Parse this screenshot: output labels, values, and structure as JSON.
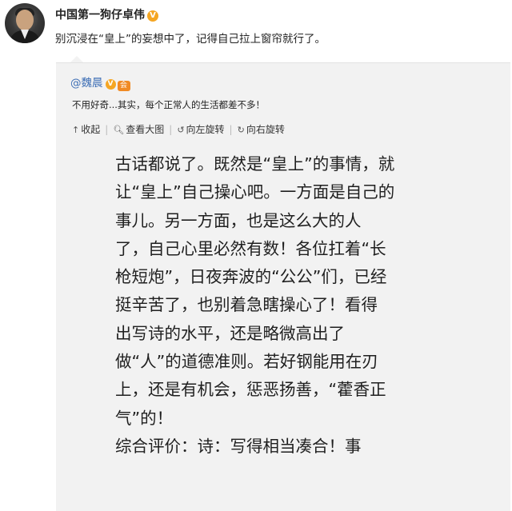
{
  "post": {
    "author": "中国第一狗仔卓伟",
    "verified_mark": "V",
    "text": "别沉浸在“皇上”的妄想中了，记得自己拉上窗帘就行了。"
  },
  "repost": {
    "author": "@魏晨",
    "verified_mark": "V",
    "member_mark": "会",
    "text": "不用好奇...其实，每个正常人的生活都差不多！",
    "toolbar": {
      "collapse": "收起",
      "view_large": "查看大图",
      "rotate_left": "向左旋转",
      "rotate_right": "向右旋转"
    },
    "image_text": [
      "古话都说了。既然是“皇上”的事情，就",
      "让“皇上”自己操心吧。一方面是自己的",
      "事儿。另一方面，也是这么大的人",
      "了，自己心里必然有数！各位扛着“长",
      "枪短炮”，日夜奔波的“公公”们，已经",
      "挺辛苦了，也别着急瞎操心了！看得",
      "出写诗的水平，还是略微高出了",
      "做“人”的道德准则。若好钢能用在刃",
      "上，还是有机会，惩恶扬善，“藿香正",
      "气”的！",
      "综合评价：诗：写得相当凑合！事"
    ]
  },
  "colors": {
    "link": "#3d6eb5",
    "verified": "#f5a623",
    "repost_bg": "#f2f2f2"
  },
  "icons": {
    "avatar": "user-photo",
    "collapse": "up-arrow-icon",
    "view_large": "magnifier-icon",
    "rotate_left": "rotate-left-icon",
    "rotate_right": "rotate-right-icon"
  }
}
